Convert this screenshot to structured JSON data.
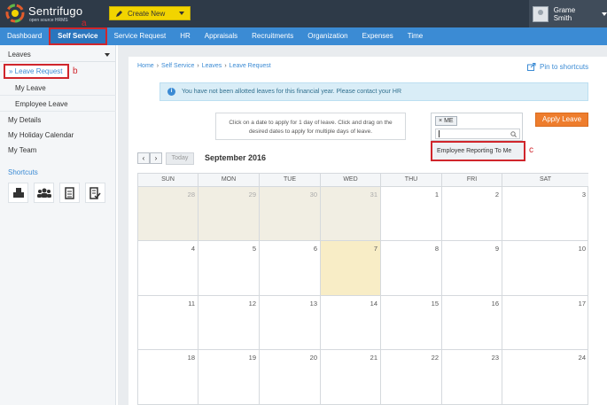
{
  "brand": {
    "name": "Sentrifugo",
    "tagline": "open source HRMS"
  },
  "topbar": {
    "create_label": "Create New",
    "user_name": "Grame Smith"
  },
  "nav": [
    "Dashboard",
    "Self Service",
    "Service Request",
    "HR",
    "Appraisals",
    "Recruitments",
    "Organization",
    "Expenses",
    "Time"
  ],
  "annotations": {
    "a": "a",
    "b": "b",
    "c": "c"
  },
  "sidebar": {
    "section": "Leaves",
    "leave_request": "» Leave Request",
    "my_leave": "My Leave",
    "employee_leave": "Employee Leave",
    "my_details": "My Details",
    "holiday_calendar": "My Holiday Calendar",
    "my_team": "My Team",
    "shortcuts": "Shortcuts"
  },
  "breadcrumb": [
    "Home",
    "Self Service",
    "Leaves",
    "Leave Request"
  ],
  "pin_label": "Pin to shortcuts",
  "info_message": "You have not been allotted leaves for this financial year. Please contact your HR",
  "instructions": [
    "Click on a date to apply for 1 day of leave. Click and drag on the",
    "desired dates to apply for multiple days of leave."
  ],
  "filter": {
    "tag": "ME",
    "tag_remove": "×",
    "option": "Employee Reporting To Me"
  },
  "apply_label": "Apply Leave",
  "calendar": {
    "prev": "‹",
    "next": "›",
    "today_label": "Today",
    "month": "September 2016",
    "days": [
      "SUN",
      "MON",
      "TUE",
      "WED",
      "THU",
      "FRI",
      "SAT"
    ],
    "weeks": [
      [
        "28",
        "29",
        "30",
        "31",
        "1",
        "2",
        "3"
      ],
      [
        "4",
        "5",
        "6",
        "7",
        "8",
        "9",
        "10"
      ],
      [
        "11",
        "12",
        "13",
        "14",
        "15",
        "16",
        "17"
      ],
      [
        "18",
        "19",
        "20",
        "21",
        "22",
        "23",
        "24"
      ]
    ],
    "other_month_days": 4,
    "today": "7",
    "colors": {
      "other": "#f1eee3",
      "today": "#f8edc6"
    }
  },
  "colors": {
    "topbar": "#2e3a48",
    "nav": "#3b8bd4",
    "accent": "#ee7d2d",
    "highlight": "#d0262c"
  }
}
